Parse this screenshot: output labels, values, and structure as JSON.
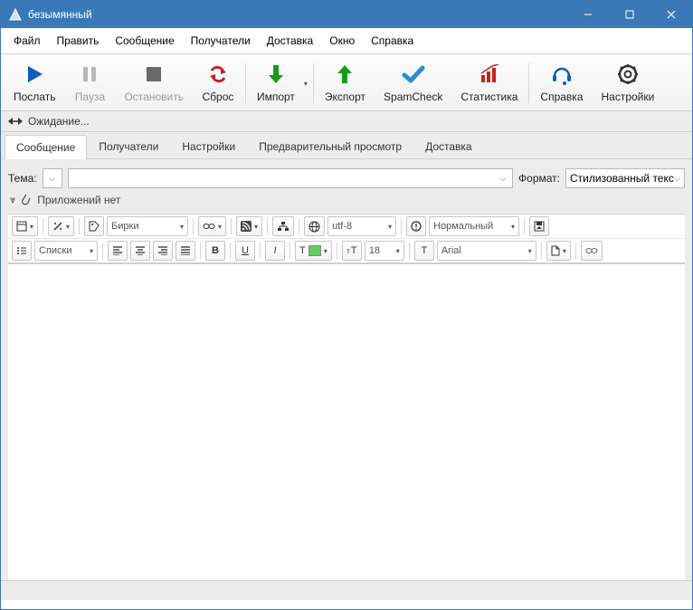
{
  "window": {
    "title": "безымянный"
  },
  "menu": {
    "file": "Файл",
    "edit": "Править",
    "message": "Сообщение",
    "recipients": "Получатели",
    "delivery": "Доставка",
    "window": "Окно",
    "help": "Справка"
  },
  "toolbar": {
    "send": "Послать",
    "pause": "Пауза",
    "stop": "Остановить",
    "reset": "Сброс",
    "import": "Импорт",
    "export": "Экспорт",
    "spamcheck": "SpamCheck",
    "stats": "Статистика",
    "help": "Справка",
    "settings": "Настройки"
  },
  "status": {
    "waiting": "Ожидание..."
  },
  "tabs": {
    "message": "Сообщение",
    "recipients": "Получатели",
    "settings": "Настройки",
    "preview": "Предварительный просмотр",
    "delivery": "Доставка"
  },
  "subject": {
    "label": "Тема:",
    "value": "",
    "format_label": "Формат:",
    "format_value": "Стилизованный текст"
  },
  "attach": {
    "none": "Приложений нет"
  },
  "edit": {
    "tags": "Бирки",
    "encoding": "utf-8",
    "priority": "Нормальный",
    "lists": "Списки",
    "fontsize": "18",
    "fontname": "Arial",
    "bold": "B",
    "underline": "U",
    "italic": "I",
    "textT": "T",
    "sizeT": "T",
    "fontT": "T"
  }
}
